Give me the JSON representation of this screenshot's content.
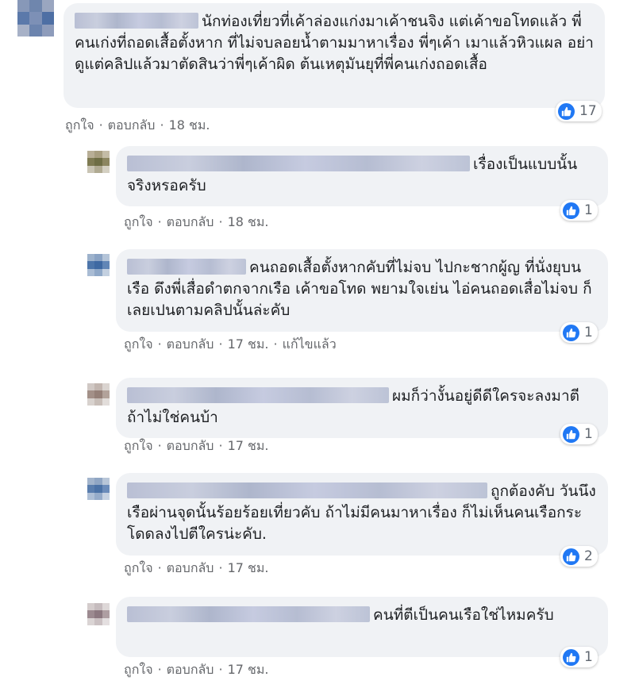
{
  "colors": {
    "bubble_bg": "#f0f2f5",
    "like_blue": "#2078f4",
    "meta_text": "#65676b"
  },
  "comments": [
    {
      "text": "นักท่องเที่ยวที่เค้าล่องแก่งมาเค้าชนจิง แต่เค้าขอโทดแล้ว พี่คนเก่งที่ถอดเสื้อตั้งหาก ที่ไม่จบลอยน้ำตามมาหาเรื่อง พี่ๆเค้า เมาแล้วหิวแผล อย่าดูแต่คลิปแล้วมาตัดสินว่าพี่ๆเค้าผิด ต้นเหตุมันยุที่พี่คนเก่งถอดเสื้อ",
      "like": "ถูกใจ",
      "reply": "ตอบกลับ",
      "time": "18 ชม.",
      "edited": "",
      "reactions": "17"
    },
    {
      "text": "เรื่องเป็นแบบนั้นจริงหรอครับ",
      "like": "ถูกใจ",
      "reply": "ตอบกลับ",
      "time": "18 ชม.",
      "edited": "",
      "reactions": "1"
    },
    {
      "text": "คนถอดเสื้อตั้งหากคับที่ไม่จบ ไปกะชากผู้ญ ที่นั่งยุบนเรือ ดึงพี่เสื่อดำตกจากเรือ เค้าขอโทด พยามใจเย่น ไอ่คนถอดเสื่อไม่จบ ก็เลยเปนตามคลิปนั้นล่ะคับ",
      "like": "ถูกใจ",
      "reply": "ตอบกลับ",
      "time": "17 ชม.",
      "edited": "แก้ไขแล้ว",
      "reactions": "1"
    },
    {
      "text": "ผมก็ว่างั้นอยู่ดีดีใครจะลงมาตีถ้าไม่ใช่คนบ้า",
      "like": "ถูกใจ",
      "reply": "ตอบกลับ",
      "time": "17 ชม.",
      "edited": "",
      "reactions": "1"
    },
    {
      "text": "ถูกต้องคับ วันนึงเรือผ่านจุดนั้นร้อยร้อยเที่ยวคับ ถ้าไม่มีคนมาหาเรื่อง ก็ไม่เห็นคนเรือกระโดดลงไปตีใครน่ะคับ.",
      "like": "ถูกใจ",
      "reply": "ตอบกลับ",
      "time": "17 ชม.",
      "edited": "",
      "reactions": "2"
    },
    {
      "text": "คนที่ตีเป็นคนเรือใช่ไหมครับ",
      "like": "ถูกใจ",
      "reply": "ตอบกลับ",
      "time": "17 ชม.",
      "edited": "",
      "reactions": "1"
    }
  ]
}
